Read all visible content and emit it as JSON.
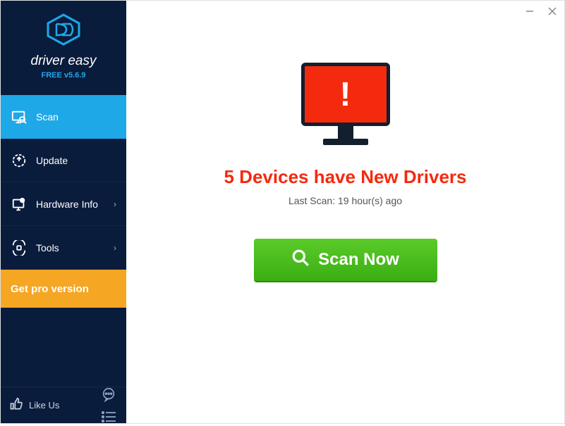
{
  "brand": {
    "name": "driver easy",
    "version": "FREE v5.6.9"
  },
  "sidebar": {
    "items": [
      {
        "label": "Scan"
      },
      {
        "label": "Update"
      },
      {
        "label": "Hardware Info"
      },
      {
        "label": "Tools"
      }
    ],
    "pro_label": "Get pro version",
    "like_label": "Like Us"
  },
  "main": {
    "headline": "5 Devices have New Drivers",
    "last_scan": "Last Scan: 19 hour(s) ago",
    "scan_button": "Scan Now"
  }
}
